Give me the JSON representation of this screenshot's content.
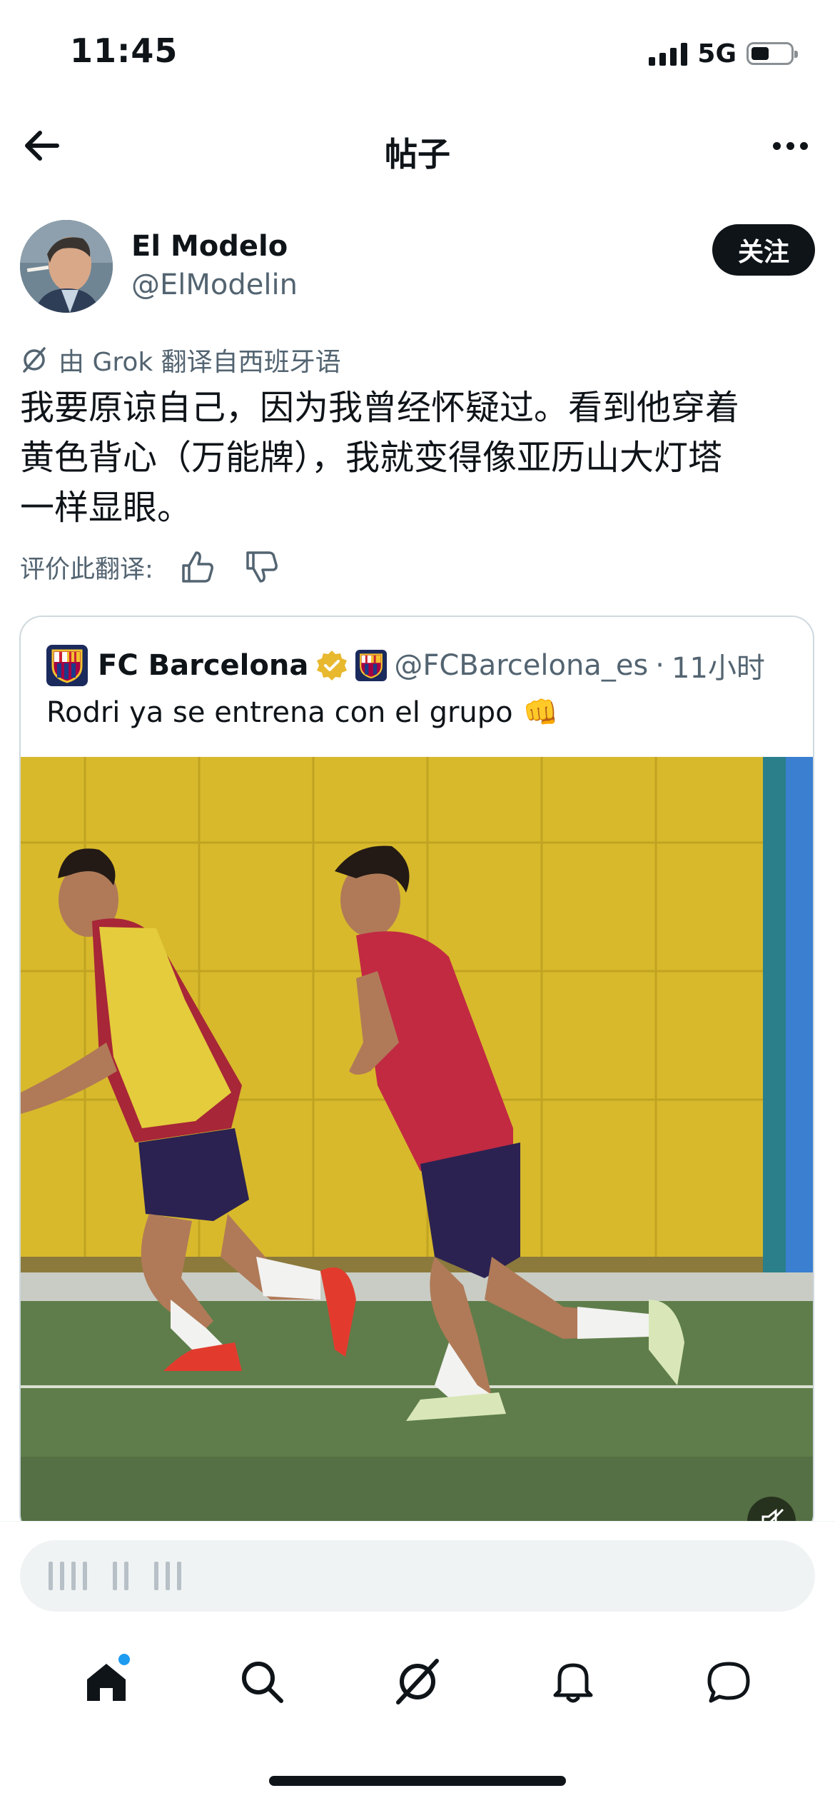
{
  "status_bar": {
    "time": "11:45",
    "network": "5G"
  },
  "header": {
    "title": "帖子"
  },
  "author": {
    "name": "El Modelo",
    "handle": "@ElModelin",
    "follow_label": "关注"
  },
  "translation": {
    "notice": "由 Grok 翻译自西班牙语",
    "rate_label": "评价此翻译:"
  },
  "post": {
    "lines": [
      "我要原谅自己，因为我曾经怀疑过。看到他穿着",
      "黄色背心（万能牌），我就变得像亚历山大灯塔",
      "一样显眼。"
    ]
  },
  "quote": {
    "name": "FC Barcelona",
    "handle": "@FCBarcelona_es",
    "separator": "·",
    "time": "11小时",
    "text": "Rodri ya se entrena con el grupo",
    "emoji": "👊"
  },
  "colors": {
    "accent": "#1d9bf0",
    "text": "#0f1419",
    "secondary": "#536471",
    "verified": "#e8b82e"
  },
  "icons": [
    "back-arrow-icon",
    "more-icon",
    "grok-icon",
    "thumbs-up-icon",
    "thumbs-down-icon",
    "verified-badge-icon",
    "mute-icon",
    "home-icon",
    "search-icon",
    "grok-tab-icon",
    "notifications-icon",
    "messages-icon"
  ]
}
